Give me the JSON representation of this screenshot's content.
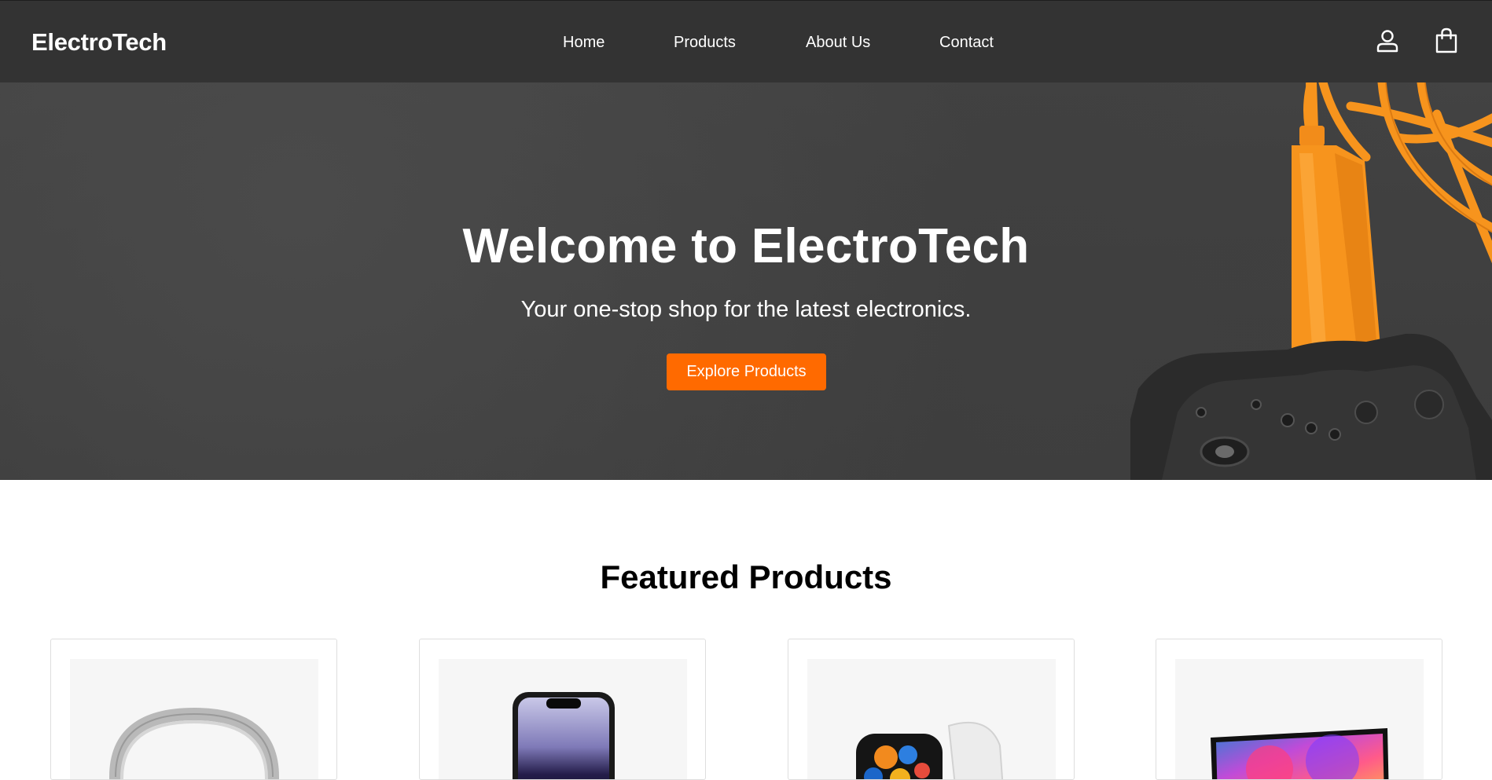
{
  "header": {
    "brand": "ElectroTech",
    "nav": [
      {
        "label": "Home"
      },
      {
        "label": "Products"
      },
      {
        "label": "About Us"
      },
      {
        "label": "Contact"
      }
    ],
    "icons": [
      "user-icon",
      "shopping-bag-icon"
    ]
  },
  "hero": {
    "title": "Welcome to ElectroTech",
    "subtitle": "Your one-stop shop for the latest electronics.",
    "cta_label": "Explore Products"
  },
  "featured": {
    "title": "Featured Products",
    "products": [
      {
        "image": "headphones-image"
      },
      {
        "image": "smartphone-image"
      },
      {
        "image": "smartwatch-image"
      },
      {
        "image": "laptop-image"
      }
    ]
  },
  "colors": {
    "nav_background": "#333333",
    "accent": "#ff6a00",
    "hero_background": "#414141",
    "cable_orange": "#f7941d"
  }
}
